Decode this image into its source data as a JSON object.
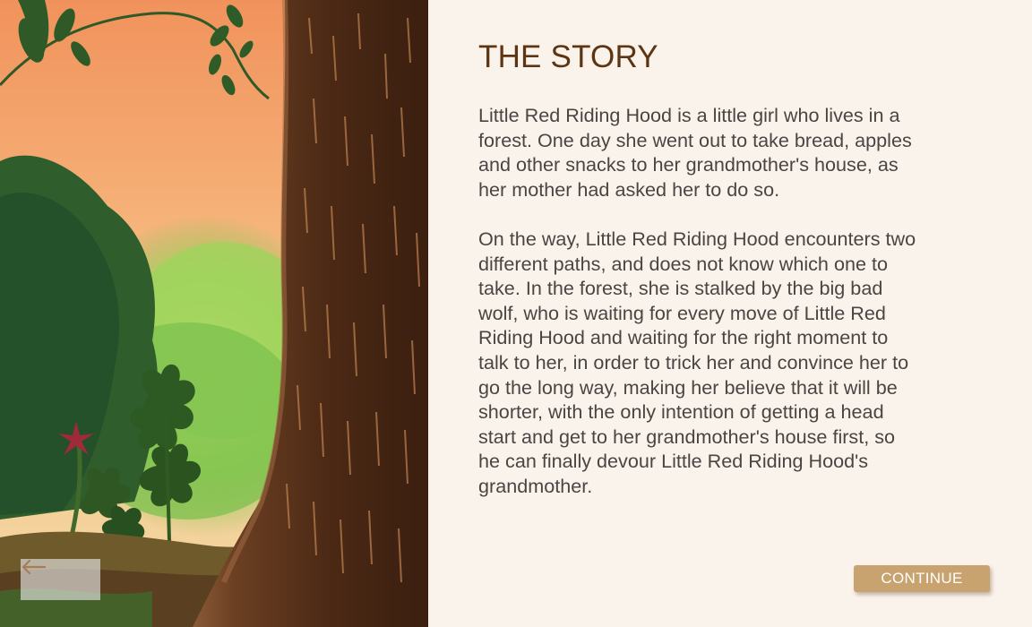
{
  "story": {
    "title": "THE STORY",
    "paragraphs": [
      "Little Red Riding Hood is a little girl who lives in a forest. One day she went out to take bread, apples and other snacks to her grandmother's house, as her mother had asked her to do so.",
      "On the way, Little Red Riding Hood encounters two different paths, and does not know which one to take. In the forest, she is stalked by the big bad wolf, who is waiting for every move of Little Red Riding Hood and waiting for the right moment to talk to her, in order to trick her and convince her to go the long way, making her believe that it will be shorter, with the only intention of getting a head start and get to her grandmother's house first, so he can finally devour Little Red Riding Hood's grandmother."
    ]
  },
  "navigation": {
    "continue_label": "CONTINUE",
    "back_icon": "arrow-left-icon"
  },
  "colors": {
    "panel_background": "#faf3ec",
    "title": "#5e3512",
    "body_text": "#4a4543",
    "continue_button": "#c9a36f",
    "back_arrow": "#a67d5a"
  }
}
